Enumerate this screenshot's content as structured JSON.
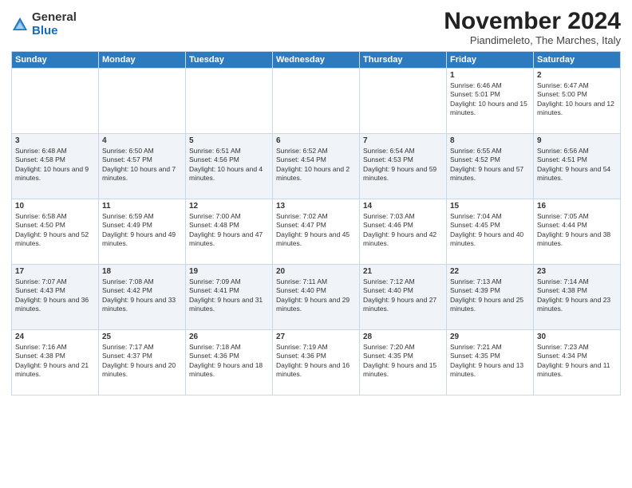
{
  "logo": {
    "general": "General",
    "blue": "Blue"
  },
  "title": "November 2024",
  "location": "Piandimeleto, The Marches, Italy",
  "headers": [
    "Sunday",
    "Monday",
    "Tuesday",
    "Wednesday",
    "Thursday",
    "Friday",
    "Saturday"
  ],
  "weeks": [
    [
      {
        "day": "",
        "info": ""
      },
      {
        "day": "",
        "info": ""
      },
      {
        "day": "",
        "info": ""
      },
      {
        "day": "",
        "info": ""
      },
      {
        "day": "",
        "info": ""
      },
      {
        "day": "1",
        "info": "Sunrise: 6:46 AM\nSunset: 5:01 PM\nDaylight: 10 hours and 15 minutes."
      },
      {
        "day": "2",
        "info": "Sunrise: 6:47 AM\nSunset: 5:00 PM\nDaylight: 10 hours and 12 minutes."
      }
    ],
    [
      {
        "day": "3",
        "info": "Sunrise: 6:48 AM\nSunset: 4:58 PM\nDaylight: 10 hours and 9 minutes."
      },
      {
        "day": "4",
        "info": "Sunrise: 6:50 AM\nSunset: 4:57 PM\nDaylight: 10 hours and 7 minutes."
      },
      {
        "day": "5",
        "info": "Sunrise: 6:51 AM\nSunset: 4:56 PM\nDaylight: 10 hours and 4 minutes."
      },
      {
        "day": "6",
        "info": "Sunrise: 6:52 AM\nSunset: 4:54 PM\nDaylight: 10 hours and 2 minutes."
      },
      {
        "day": "7",
        "info": "Sunrise: 6:54 AM\nSunset: 4:53 PM\nDaylight: 9 hours and 59 minutes."
      },
      {
        "day": "8",
        "info": "Sunrise: 6:55 AM\nSunset: 4:52 PM\nDaylight: 9 hours and 57 minutes."
      },
      {
        "day": "9",
        "info": "Sunrise: 6:56 AM\nSunset: 4:51 PM\nDaylight: 9 hours and 54 minutes."
      }
    ],
    [
      {
        "day": "10",
        "info": "Sunrise: 6:58 AM\nSunset: 4:50 PM\nDaylight: 9 hours and 52 minutes."
      },
      {
        "day": "11",
        "info": "Sunrise: 6:59 AM\nSunset: 4:49 PM\nDaylight: 9 hours and 49 minutes."
      },
      {
        "day": "12",
        "info": "Sunrise: 7:00 AM\nSunset: 4:48 PM\nDaylight: 9 hours and 47 minutes."
      },
      {
        "day": "13",
        "info": "Sunrise: 7:02 AM\nSunset: 4:47 PM\nDaylight: 9 hours and 45 minutes."
      },
      {
        "day": "14",
        "info": "Sunrise: 7:03 AM\nSunset: 4:46 PM\nDaylight: 9 hours and 42 minutes."
      },
      {
        "day": "15",
        "info": "Sunrise: 7:04 AM\nSunset: 4:45 PM\nDaylight: 9 hours and 40 minutes."
      },
      {
        "day": "16",
        "info": "Sunrise: 7:05 AM\nSunset: 4:44 PM\nDaylight: 9 hours and 38 minutes."
      }
    ],
    [
      {
        "day": "17",
        "info": "Sunrise: 7:07 AM\nSunset: 4:43 PM\nDaylight: 9 hours and 36 minutes."
      },
      {
        "day": "18",
        "info": "Sunrise: 7:08 AM\nSunset: 4:42 PM\nDaylight: 9 hours and 33 minutes."
      },
      {
        "day": "19",
        "info": "Sunrise: 7:09 AM\nSunset: 4:41 PM\nDaylight: 9 hours and 31 minutes."
      },
      {
        "day": "20",
        "info": "Sunrise: 7:11 AM\nSunset: 4:40 PM\nDaylight: 9 hours and 29 minutes."
      },
      {
        "day": "21",
        "info": "Sunrise: 7:12 AM\nSunset: 4:40 PM\nDaylight: 9 hours and 27 minutes."
      },
      {
        "day": "22",
        "info": "Sunrise: 7:13 AM\nSunset: 4:39 PM\nDaylight: 9 hours and 25 minutes."
      },
      {
        "day": "23",
        "info": "Sunrise: 7:14 AM\nSunset: 4:38 PM\nDaylight: 9 hours and 23 minutes."
      }
    ],
    [
      {
        "day": "24",
        "info": "Sunrise: 7:16 AM\nSunset: 4:38 PM\nDaylight: 9 hours and 21 minutes."
      },
      {
        "day": "25",
        "info": "Sunrise: 7:17 AM\nSunset: 4:37 PM\nDaylight: 9 hours and 20 minutes."
      },
      {
        "day": "26",
        "info": "Sunrise: 7:18 AM\nSunset: 4:36 PM\nDaylight: 9 hours and 18 minutes."
      },
      {
        "day": "27",
        "info": "Sunrise: 7:19 AM\nSunset: 4:36 PM\nDaylight: 9 hours and 16 minutes."
      },
      {
        "day": "28",
        "info": "Sunrise: 7:20 AM\nSunset: 4:35 PM\nDaylight: 9 hours and 15 minutes."
      },
      {
        "day": "29",
        "info": "Sunrise: 7:21 AM\nSunset: 4:35 PM\nDaylight: 9 hours and 13 minutes."
      },
      {
        "day": "30",
        "info": "Sunrise: 7:23 AM\nSunset: 4:34 PM\nDaylight: 9 hours and 11 minutes."
      }
    ]
  ]
}
